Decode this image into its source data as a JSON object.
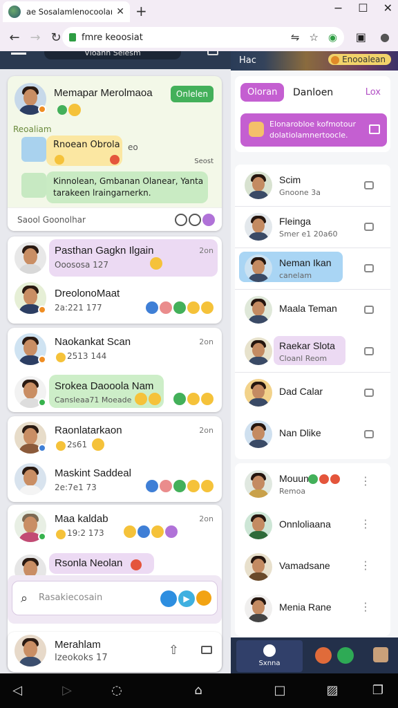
{
  "browser": {
    "tab_title": "ae Sosalamlenocoolam",
    "url": "fmre keoosiat"
  },
  "left": {
    "header_label": "Vloann Selesm",
    "top_card": {
      "name": "Memapar Merolmaoa",
      "button": "Onlelen",
      "section_label": "Reoaliam",
      "msg1": "Rnoean Obrola",
      "msg1_time": "eo",
      "msg1_side": "Seost",
      "msg2": "Kinnolean, Gmbanan Olanear, Yanta tarakeen lraingarnerkn.",
      "footer": "Saool Goonolhar"
    },
    "chats": [
      {
        "name": "Pasthan Gagkn Ilgain",
        "sub": "Ooososa 127",
        "time": "2on"
      },
      {
        "name": "DreolonoMaat",
        "sub": "2a:221 177",
        "time": ""
      },
      {
        "name": "Naokankat Scan",
        "sub": "2513 144",
        "time": "2on"
      },
      {
        "name": "Srokea Daooola Nam",
        "sub": "Cansleaa71 Moeade",
        "time": ""
      },
      {
        "name": "Raonlatarkaon",
        "sub": "2s61",
        "time": "2on"
      },
      {
        "name": "Maskint Saddeal",
        "sub": "2e:7e1 73",
        "time": ""
      },
      {
        "name": "Maa kaldab",
        "sub": "19:2 173",
        "time": "2on"
      },
      {
        "name": "Rsonla Neolan",
        "sub": "",
        "time": ""
      }
    ],
    "search_placeholder": "Rasakiecosain",
    "footer_chat": {
      "name": "Merahlam",
      "sub": "Izeokoks 17"
    }
  },
  "right": {
    "header_title": "Hac",
    "header_badge": "Enooalean",
    "seg_active": "Oloran",
    "seg_other": "Danloen",
    "seg_link": "Lox",
    "notice": "Elonarobloe kofmotour dolatiolamnertoocle.",
    "contacts": [
      {
        "name": "Scim",
        "sub": "Gnoone 3a"
      },
      {
        "name": "Fleinga",
        "sub": "Smer e1 20a60"
      },
      {
        "name": "Neman Ikan",
        "sub": "canelam"
      },
      {
        "name": "Maala Teman",
        "sub": ""
      },
      {
        "name": "Raekar Slota",
        "sub": "Cloanl Reom"
      },
      {
        "name": "Dad Calar",
        "sub": ""
      },
      {
        "name": "Nan Dlike",
        "sub": ""
      }
    ],
    "people": [
      {
        "name": "Mouun",
        "sub": "Remoa"
      },
      {
        "name": "Onnloliaana",
        "sub": ""
      },
      {
        "name": "Vamadsane",
        "sub": ""
      },
      {
        "name": "Menia Rane",
        "sub": ""
      }
    ],
    "bottom_label": "Sxnna"
  },
  "icons": {
    "back": "arrow-left-icon",
    "forward": "arrow-right-icon",
    "reload": "reload-icon",
    "star": "star-icon",
    "search": "search-icon"
  }
}
